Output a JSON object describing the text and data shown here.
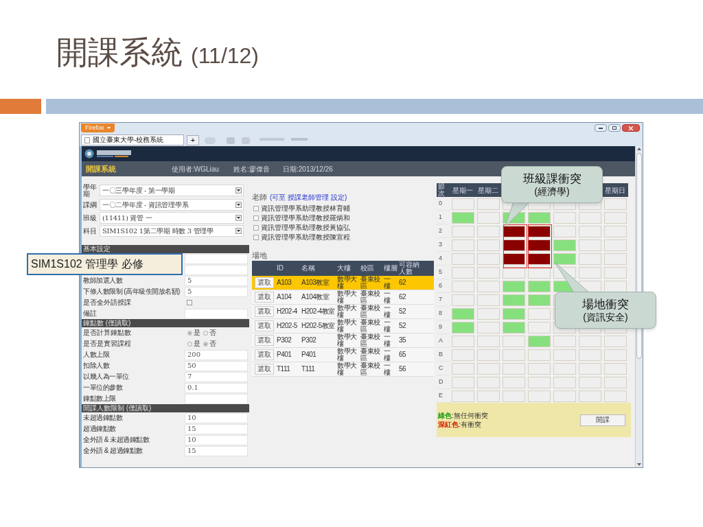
{
  "slide": {
    "title": "開課系統",
    "page": "(11/12)"
  },
  "browser": {
    "menu_button": "Firefox",
    "tab_title": "國立臺東大學-校務系統",
    "new_tab": "+"
  },
  "header": {
    "app_title": "開課系統",
    "user": "使用者:WGLiau",
    "name": "姓名:廖偉音",
    "date": "日期:2013/12/26"
  },
  "selects": [
    {
      "label": "學年期",
      "value": "一〇三學年度 - 第一學期"
    },
    {
      "label": "課綱",
      "value": "一〇二學年度 - 資訊管理學系"
    },
    {
      "label": "班級",
      "value": "(11411) 資管 一"
    },
    {
      "label": "科目",
      "value": "SIM1S102 1第二學期 時數 3 管理學"
    }
  ],
  "form": [
    {
      "kind": "section",
      "label": "基本設定"
    },
    {
      "kind": "blank"
    },
    {
      "kind": "blank"
    },
    {
      "kind": "input",
      "label": "教師加選人數",
      "value": "5"
    },
    {
      "kind": "input",
      "label": "下修人數限制 (高年級生開放名額)",
      "value": "5"
    },
    {
      "kind": "checkbox",
      "label": "是否全外語授課",
      "checked": false
    },
    {
      "kind": "input",
      "label": "備註"
    },
    {
      "kind": "section",
      "label": "鐘點數 (僅讀取)"
    },
    {
      "kind": "radio",
      "label": "是否計算鐘點數",
      "options": [
        {
          "label": "是",
          "selected": true
        },
        {
          "label": "否",
          "selected": false
        }
      ]
    },
    {
      "kind": "radio",
      "label": "是否是實習課程",
      "options": [
        {
          "label": "是",
          "selected": false
        },
        {
          "label": "否",
          "selected": true
        }
      ]
    },
    {
      "kind": "input",
      "label": "人數上限",
      "value": "200"
    },
    {
      "kind": "input",
      "label": "扣除人數",
      "value": "50"
    },
    {
      "kind": "input",
      "label": "以幾人為一單位",
      "value": "7"
    },
    {
      "kind": "input",
      "label": "一單位的參數",
      "value": "0.1"
    },
    {
      "kind": "input",
      "label": "鐘點數上限"
    },
    {
      "kind": "section",
      "label": "開課人數限制 (僅讀取)"
    },
    {
      "kind": "input",
      "label": "未超過鐘點數",
      "value": "10"
    },
    {
      "kind": "input",
      "label": "超過鐘點數",
      "value": "15"
    },
    {
      "kind": "input",
      "label": "全外語 & 未超過鐘點數",
      "value": "10"
    },
    {
      "kind": "input",
      "label": "全外語 & 超過鐘點數",
      "value": "15"
    }
  ],
  "teachers": {
    "title": "老師",
    "hint": "(可至 授課老師管理 設定)",
    "items": [
      {
        "name": "資訊管理學系助理教授林育輔",
        "checked": false
      },
      {
        "name": "資訊管理學系助理教授羅炳和",
        "checked": false
      },
      {
        "name": "資訊管理學系助理教授黃協弘",
        "checked": false
      },
      {
        "name": "資訊管理學系助理教授陳宣程",
        "checked": false
      }
    ]
  },
  "rooms": {
    "title": "場地",
    "columns": [
      "ID",
      "名稱",
      "大樓",
      "校區",
      "樓層",
      "可容納人數"
    ],
    "rows": [
      {
        "button": "選取",
        "selected": true,
        "cells": [
          "A103",
          "A103教室",
          "數學大樓",
          "臺東校區",
          "一樓",
          "62"
        ]
      },
      {
        "button": "選取",
        "selected": false,
        "cells": [
          "A104",
          "A104教室",
          "數學大樓",
          "臺東校區",
          "一樓",
          "62"
        ]
      },
      {
        "button": "選取",
        "selected": false,
        "cells": [
          "H202-4",
          "H202-4教室",
          "數學大樓",
          "臺東校區",
          "一樓",
          "52"
        ]
      },
      {
        "button": "選取",
        "selected": false,
        "cells": [
          "H202-5",
          "H202-5教室",
          "數學大樓",
          "臺東校區",
          "一樓",
          "52"
        ]
      },
      {
        "button": "選取",
        "selected": false,
        "cells": [
          "P302",
          "P302",
          "數學大樓",
          "臺東校區",
          "一樓",
          "35"
        ]
      },
      {
        "button": "選取",
        "selected": false,
        "cells": [
          "P401",
          "P401",
          "數學大樓",
          "臺東校區",
          "一樓",
          "65"
        ]
      },
      {
        "button": "選取",
        "selected": false,
        "cells": [
          "T111",
          "T111",
          "數學大樓",
          "臺東校區",
          "一樓",
          "56"
        ]
      }
    ]
  },
  "schedule": {
    "corner": "節次",
    "columns": [
      {
        "label": "星期一"
      },
      {
        "label": "星期二"
      },
      {
        "label": "星期日"
      }
    ],
    "rows": [
      {
        "label": "0",
        "cells": [
          {
            "color": "#efefef"
          },
          {
            "color": "#efefef"
          },
          {
            "color": "#efefef"
          },
          {
            "color": "#efefef"
          },
          {
            "color": "#efefef"
          },
          {
            "color": "#efefef"
          },
          {
            "color": "#efefef"
          }
        ]
      },
      {
        "label": "1",
        "cells": [
          {
            "color": "#86e07e"
          },
          {
            "color": "#efefef"
          },
          {
            "color": "#86e07e"
          },
          {
            "color": "#86e07e"
          },
          {
            "color": "#efefef"
          },
          {
            "color": "#efefef"
          },
          {
            "color": "#efefef"
          }
        ]
      },
      {
        "label": "2",
        "cells": [
          {
            "color": "#efefef"
          },
          {
            "color": "#efefef"
          },
          {
            "color": "#8b0000"
          },
          {
            "color": "#8b0000"
          },
          {
            "color": "#efefef"
          },
          {
            "color": "#efefef"
          },
          {
            "color": "#efefef"
          }
        ]
      },
      {
        "label": "3",
        "cells": [
          {
            "color": "#efefef"
          },
          {
            "color": "#efefef"
          },
          {
            "color": "#8b0000"
          },
          {
            "color": "#8b0000"
          },
          {
            "color": "#86e07e"
          },
          {
            "color": "#efefef"
          },
          {
            "color": "#efefef"
          }
        ]
      },
      {
        "label": "4",
        "cells": [
          {
            "color": "#efefef"
          },
          {
            "color": "#efefef"
          },
          {
            "color": "#8b0000"
          },
          {
            "color": "#8b0000"
          },
          {
            "color": "#86e07e"
          },
          {
            "color": "#efefef"
          },
          {
            "color": "#efefef"
          }
        ]
      },
      {
        "label": "5",
        "cells": [
          {
            "color": "#efefef"
          },
          {
            "color": "#efefef"
          },
          {
            "color": "#efefef"
          },
          {
            "color": "#efefef"
          },
          {
            "color": "#efefef"
          },
          {
            "color": "#efefef"
          },
          {
            "color": "#efefef"
          }
        ]
      },
      {
        "label": "6",
        "cells": [
          {
            "color": "#efefef"
          },
          {
            "color": "#efefef"
          },
          {
            "color": "#86e07e"
          },
          {
            "color": "#86e07e"
          },
          {
            "color": "#86e07e"
          },
          {
            "color": "#efefef"
          },
          {
            "color": "#efefef"
          }
        ]
      },
      {
        "label": "7",
        "cells": [
          {
            "color": "#efefef"
          },
          {
            "color": "#efefef"
          },
          {
            "color": "#86e07e"
          },
          {
            "color": "#86e07e"
          },
          {
            "color": "#efefef"
          }
        ]
      },
      {
        "label": "8",
        "cells": [
          {
            "color": "#86e07e"
          },
          {
            "color": "#efefef"
          },
          {
            "color": "#86e07e"
          },
          {
            "color": "#efefef"
          },
          {
            "color": "#efefef"
          }
        ]
      },
      {
        "label": "9",
        "cells": [
          {
            "color": "#86e07e"
          },
          {
            "color": "#efefef"
          },
          {
            "color": "#86e07e"
          },
          {
            "color": "#efefef"
          },
          {
            "color": "#efefef"
          },
          {
            "color": "#efefef"
          },
          {
            "color": "#efefef"
          }
        ]
      },
      {
        "label": "A",
        "cells": [
          {
            "color": "#efefef"
          },
          {
            "color": "#efefef"
          },
          {
            "color": "#efefef"
          },
          {
            "color": "#86e07e"
          },
          {
            "color": "#efefef"
          },
          {
            "color": "#efefef"
          },
          {
            "color": "#efefef"
          }
        ]
      },
      {
        "label": "B",
        "cells": [
          {
            "color": "#efefef"
          },
          {
            "color": "#efefef"
          },
          {
            "color": "#efefef"
          },
          {
            "color": "#efefef"
          },
          {
            "color": "#efefef"
          },
          {
            "color": "#efefef"
          },
          {
            "color": "#efefef"
          }
        ]
      },
      {
        "label": "C",
        "cells": [
          {
            "color": "#efefef"
          },
          {
            "color": "#efefef"
          },
          {
            "color": "#efefef"
          },
          {
            "color": "#efefef"
          },
          {
            "color": "#efefef"
          },
          {
            "color": "#efefef"
          },
          {
            "color": "#efefef"
          }
        ]
      },
      {
        "label": "D",
        "cells": [
          {
            "color": "#efefef"
          },
          {
            "color": "#efefef"
          },
          {
            "color": "#efefef"
          },
          {
            "color": "#efefef"
          },
          {
            "color": "#efefef"
          },
          {
            "color": "#efefef"
          },
          {
            "color": "#efefef"
          }
        ]
      },
      {
        "label": "E",
        "cells": [
          {
            "color": "#efefef"
          },
          {
            "color": "#efefef"
          },
          {
            "color": "#efefef"
          },
          {
            "color": "#efefef"
          },
          {
            "color": "#efefef"
          },
          {
            "color": "#efefef"
          },
          {
            "color": "#efefef"
          }
        ]
      }
    ],
    "legend": [
      {
        "name": "綠色",
        "text": ":無任何衝突",
        "color": "#1a9a1a"
      },
      {
        "name": "深紅色",
        "text": ":有衝突",
        "color": "#d02000"
      }
    ],
    "button": "開課"
  },
  "label_box": "SIM1S102 管理學 必修",
  "callouts": [
    {
      "lines": [
        "班級課衝突",
        "(經濟學)"
      ]
    },
    {
      "lines": [
        "場地衝突",
        "(資訊安全)"
      ]
    }
  ]
}
